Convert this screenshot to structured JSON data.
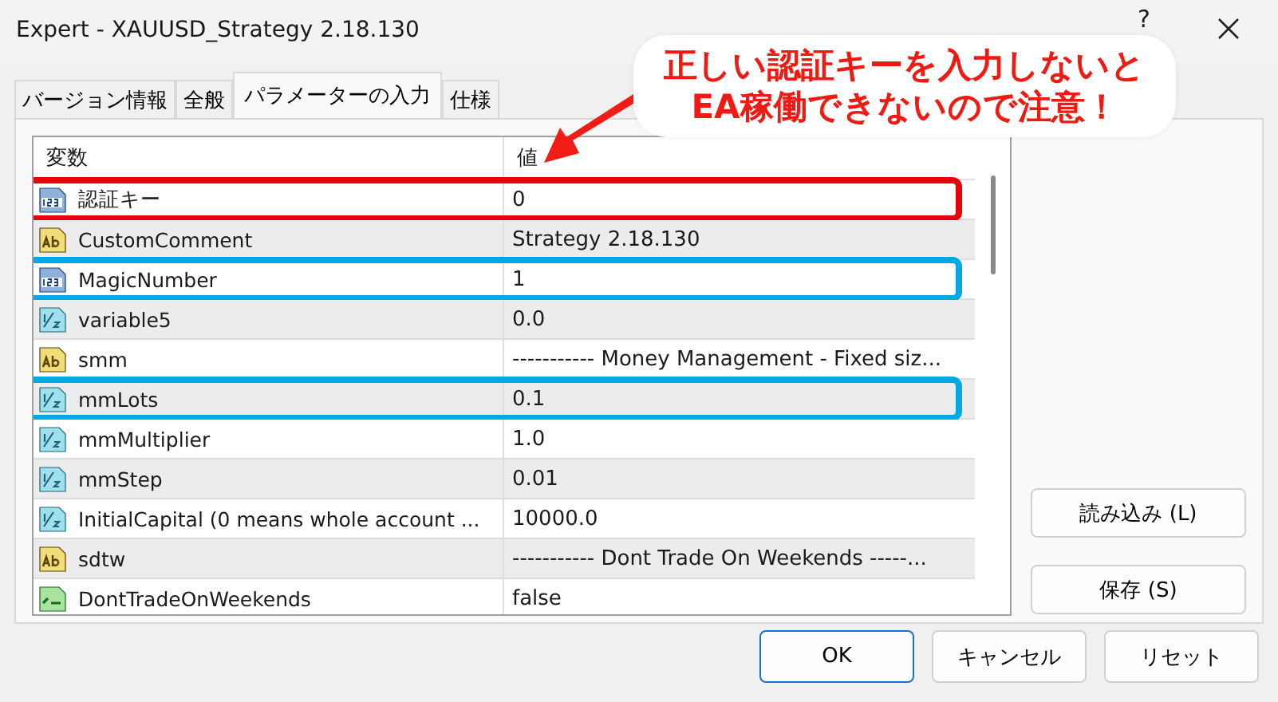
{
  "window": {
    "title": "Expert - XAUUSD_Strategy 2.18.130",
    "help": "?"
  },
  "tabs": [
    {
      "label": "バージョン情報",
      "selected": false
    },
    {
      "label": "全般",
      "selected": false
    },
    {
      "label": "パラメーターの入力",
      "selected": true
    },
    {
      "label": "仕様",
      "selected": false
    }
  ],
  "table": {
    "columns": [
      "変数",
      "値"
    ],
    "rows": [
      {
        "kind": "int",
        "name": "認証キー",
        "value": "0",
        "color": "#e8000b"
      },
      {
        "kind": "string",
        "name": "CustomComment",
        "value": "Strategy 2.18.130"
      },
      {
        "kind": "int",
        "name": "MagicNumber",
        "value": "1",
        "color": "#00a8e4"
      },
      {
        "kind": "double",
        "name": "variable5",
        "value": "0.0"
      },
      {
        "kind": "string",
        "name": "smm",
        "value": "----------- Money Management - Fixed siz..."
      },
      {
        "kind": "double",
        "name": "mmLots",
        "value": "0.1",
        "color": "#00a8e4"
      },
      {
        "kind": "double",
        "name": "mmMultiplier",
        "value": "1.0"
      },
      {
        "kind": "double",
        "name": "mmStep",
        "value": "0.01"
      },
      {
        "kind": "double",
        "name": "InitialCapital (0 means whole account ...",
        "value": "10000.0"
      },
      {
        "kind": "string",
        "name": "sdtw",
        "value": "----------- Dont Trade On Weekends -----..."
      },
      {
        "kind": "bool",
        "name": "DontTradeOnWeekends",
        "value": "false"
      }
    ]
  },
  "side_buttons": [
    "読み込み (L)",
    "保存 (S)"
  ],
  "buttons": [
    {
      "label": "OK",
      "default": true
    },
    {
      "label": "キャンセル",
      "default": false
    },
    {
      "label": "リセット",
      "default": false
    }
  ],
  "callout": {
    "lines": [
      "正しい認証キーを入力しないと",
      "EA稼働できないので注意！"
    ]
  }
}
